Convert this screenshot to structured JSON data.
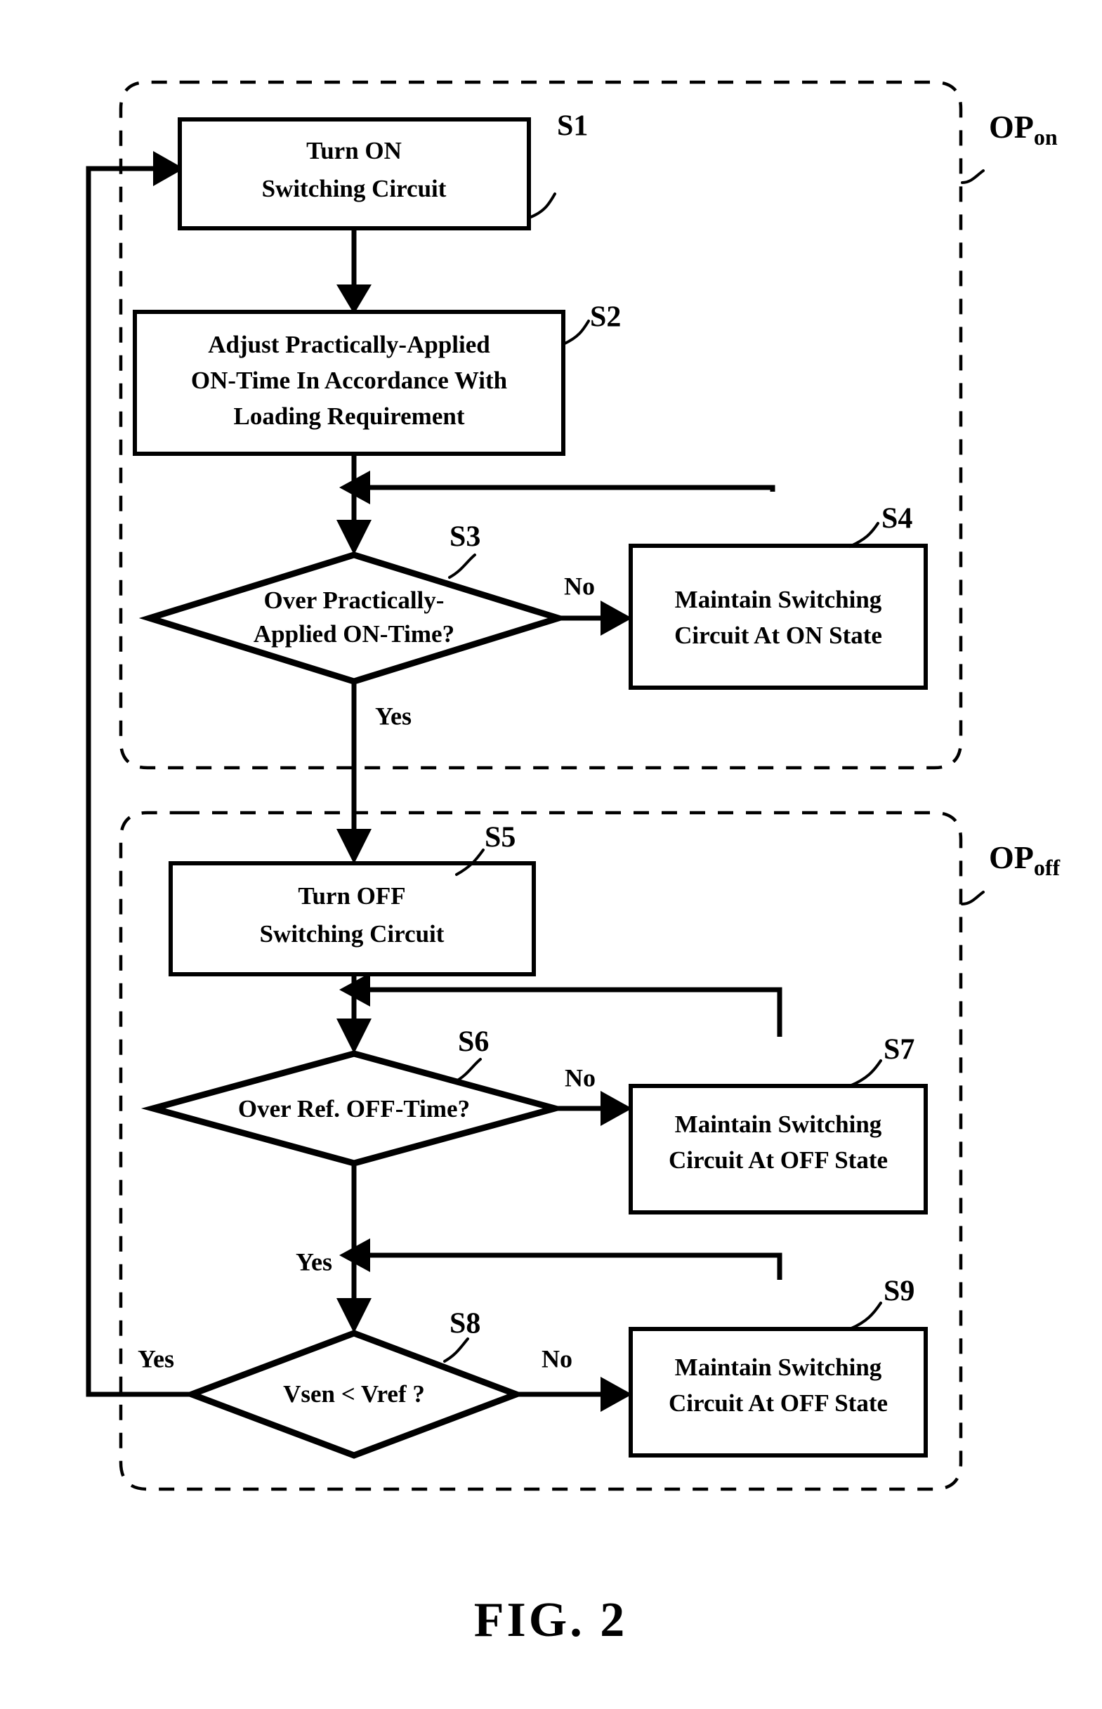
{
  "figure": {
    "caption": "FIG. 2",
    "type": "patent-flowchart"
  },
  "groups": [
    {
      "id": "OPon",
      "ref_main": "OP",
      "ref_sub": "on"
    },
    {
      "id": "OPoff",
      "ref_main": "OP",
      "ref_sub": "off"
    }
  ],
  "nodes": [
    {
      "id": "S1",
      "ref": "S1",
      "shape": "process",
      "group": "OPon",
      "lines": [
        "Turn ON",
        "Switching Circuit"
      ]
    },
    {
      "id": "S2",
      "ref": "S2",
      "shape": "process",
      "group": "OPon",
      "lines": [
        "Adjust Practically-Applied",
        "ON-Time In Accordance With",
        "Loading Requirement"
      ]
    },
    {
      "id": "S3",
      "ref": "S3",
      "shape": "decision",
      "group": "OPon",
      "lines": [
        "Over Practically-",
        "Applied ON-Time?"
      ]
    },
    {
      "id": "S4",
      "ref": "S4",
      "shape": "process",
      "group": "OPon",
      "lines": [
        "Maintain Switching",
        "Circuit At ON State"
      ]
    },
    {
      "id": "S5",
      "ref": "S5",
      "shape": "process",
      "group": "OPoff",
      "lines": [
        "Turn OFF",
        "Switching Circuit"
      ]
    },
    {
      "id": "S6",
      "ref": "S6",
      "shape": "decision",
      "group": "OPoff",
      "lines": [
        "Over Ref. OFF-Time?"
      ]
    },
    {
      "id": "S7",
      "ref": "S7",
      "shape": "process",
      "group": "OPoff",
      "lines": [
        "Maintain Switching",
        "Circuit At OFF State"
      ]
    },
    {
      "id": "S8",
      "ref": "S8",
      "shape": "decision",
      "group": "OPoff",
      "lines": [
        "Vsen < Vref ?"
      ]
    },
    {
      "id": "S9",
      "ref": "S9",
      "shape": "process",
      "group": "OPoff",
      "lines": [
        "Maintain Switching",
        "Circuit At OFF State"
      ]
    }
  ],
  "branch_labels": {
    "s3_no": "No",
    "s3_yes": "Yes",
    "s6_no": "No",
    "s6_yes": "Yes",
    "s8_no": "No",
    "s8_yes": "Yes"
  },
  "text": {
    "s1_l1": "Turn ON",
    "s1_l2": "Switching Circuit",
    "s2_l1": "Adjust Practically-Applied",
    "s2_l2": "ON-Time In Accordance With",
    "s2_l3": "Loading Requirement",
    "s3_l1": "Over Practically-",
    "s3_l2": "Applied ON-Time?",
    "s4_l1": "Maintain Switching",
    "s4_l2": "Circuit At ON State",
    "s5_l1": "Turn OFF",
    "s5_l2": "Switching Circuit",
    "s6_l1": "Over Ref. OFF-Time?",
    "s7_l1": "Maintain Switching",
    "s7_l2": "Circuit At OFF State",
    "s8_l1": "Vsen < Vref ?",
    "s9_l1": "Maintain Switching",
    "s9_l2": "Circuit At OFF State",
    "ref_s1": "S1",
    "ref_s2": "S2",
    "ref_s3": "S3",
    "ref_s4": "S4",
    "ref_s5": "S5",
    "ref_s6": "S6",
    "ref_s7": "S7",
    "ref_s8": "S8",
    "ref_s9": "S9",
    "op_on_main": "OP",
    "op_on_sub": "on",
    "op_off_main": "OP",
    "op_off_sub": "off",
    "caption": "FIG. 2"
  },
  "colors": {
    "ink": "#000000",
    "paper": "#ffffff"
  }
}
